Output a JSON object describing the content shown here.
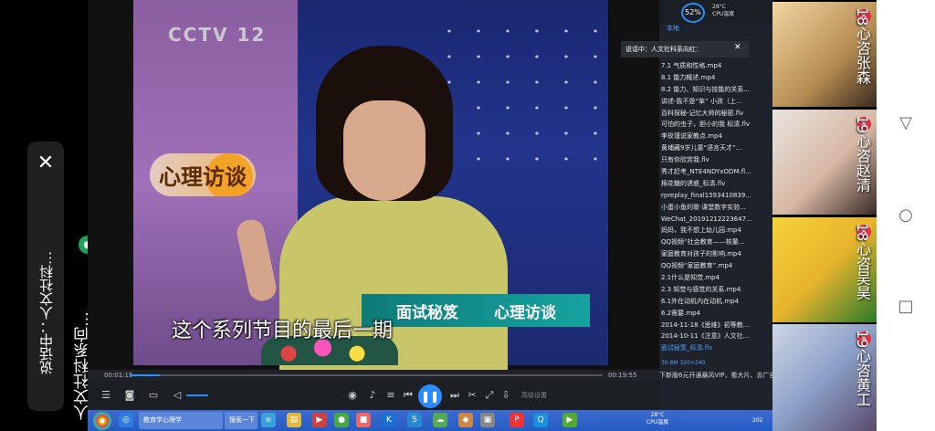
{
  "call": {
    "status": "说话中：人文社科…",
    "title": "人文社科系向…",
    "close_icon": "close-icon",
    "mic_icon": "mic-icon"
  },
  "video": {
    "channel_logo": "CCTV 12",
    "show_logo": "心理访谈",
    "lower_third_title": "面试秘笈",
    "lower_third_logo": "心理访谈",
    "subtitle": "这个系列节目的最后一期"
  },
  "player": {
    "time_current": "00:01:15",
    "time_total": "00:19:55",
    "progress": 0.063,
    "extra_label": "高级设置",
    "right_label": "剪辑"
  },
  "playlist": {
    "cpu_percent": "52%",
    "temp": "28°C",
    "temp_label": "CPU温度",
    "tab": "本地",
    "popup_text": "说话中：人文社科系向红：",
    "items": [
      "7.1 气质和性格.mp4",
      "8.1 能力概述.mp4",
      "8.2 能力、知识与技能的关系...",
      "讲述-我不是“笨” 小孩（上...",
      "百科探秘-记忆大师的秘密.flv",
      "可怕的虫子，胆小的我 标清.flv",
      "李玫瑾说家教点.mp4",
      "黄埔藏9岁儿童“语言天才”...",
      "只有你欣赏我.flv",
      "秀才赶考_NTE4NDYxODM.fl...",
      "棉花糖的诱惑_标清.flv",
      "rpreplay_final1593410839...",
      "小蛋小鱼的歌·课堂数字实验...",
      "WeChat_20191212223647...",
      "妈妈，我不想上幼儿园.mp4",
      "QQ视频“社会教育——核董...",
      "家庭教育对孩子的影响.mp4",
      "QQ视频“家庭教育”.mp4",
      "2.1什么是知觉.mp4",
      "2.3 知觉与感觉的关系.mp4",
      "6.1外在动机内在动机.mp4",
      "6.2需要.mp4",
      "2014-11-18《思维》初等教...",
      "2014-10-11《注意》人文社...",
      "面试秘笈_标清.flv"
    ],
    "active_index": 24,
    "file_info": "30.8M   320×240",
    "vip_banner": "下新版6元开通暴风VIP，看大片、去广告"
  },
  "taskbar": {
    "window_title": "教育学心理学",
    "search": "搜索一下",
    "tray_temp": "28°C",
    "tray_label": "CPU温度",
    "year": "202"
  },
  "participants": [
    {
      "name": "18心咨张森",
      "mic": "mic-off-icon"
    },
    {
      "name": "19心咨赵清",
      "mic": "mic-off-icon"
    },
    {
      "name": "18心咨吴昊",
      "mic": "mic-off-icon"
    },
    {
      "name": "19心咨黄工",
      "mic": "mic-off-icon"
    }
  ],
  "colors": {
    "accent": "#2b8cff",
    "mic_off": "#e0334a",
    "mic_on": "#1ea35b",
    "lower_third": "#17a3a0"
  }
}
